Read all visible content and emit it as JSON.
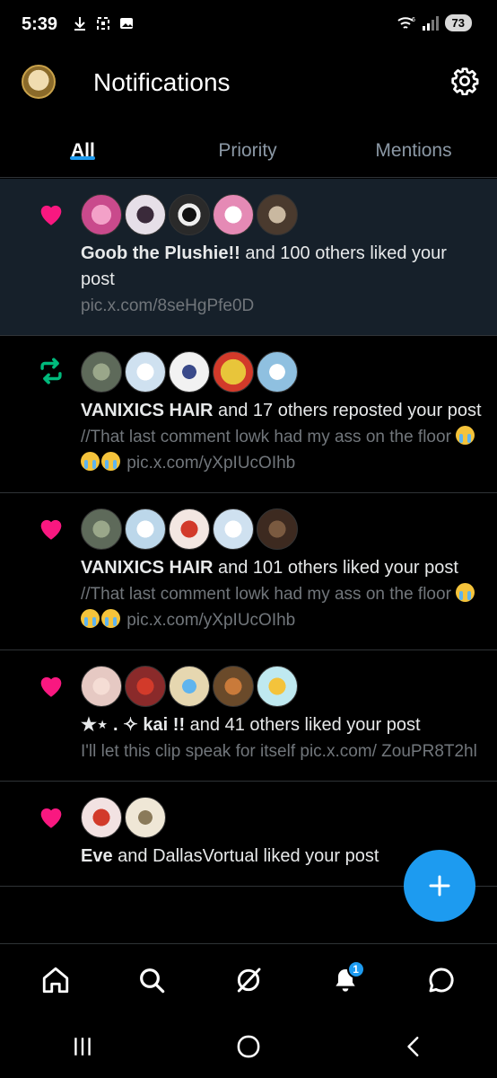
{
  "status_bar": {
    "time": "5:39",
    "battery": "73",
    "network": "6"
  },
  "header": {
    "title": "Notifications"
  },
  "tabs": [
    {
      "label": "All",
      "active": true
    },
    {
      "label": "Priority",
      "active": false
    },
    {
      "label": "Mentions",
      "active": false
    }
  ],
  "notifications": [
    {
      "kind": "like",
      "highlight": true,
      "name": "Goob the Plushie!!",
      "rest": " and 100 others liked your post",
      "sub": "pic.x.com/8seHgPfe0D",
      "avatar_colors": [
        "#c94a8c",
        "#e6dfe8",
        "#2a2a2a",
        "#e58ab5",
        "#4a3a2e"
      ]
    },
    {
      "kind": "repost",
      "highlight": false,
      "name": "VANIXICS HAIR",
      "rest": " and 17 others reposted your post",
      "sub": "//That last comment lowk had my ass on the floor",
      "sub_link": "pic.x.com/yXpIUcOIhb",
      "avatar_colors": [
        "#5e6a5a",
        "#cfe1f0",
        "#f2f2f2",
        "#e8c53a",
        "#8fc0e0"
      ]
    },
    {
      "kind": "like",
      "highlight": false,
      "name": "VANIXICS HAIR",
      "rest": " and 101 others liked your post",
      "sub": "//That last comment lowk had my ass on the floor",
      "sub_link": "pic.x.com/yXpIUcOIhb",
      "avatar_colors": [
        "#5e6a5a",
        "#bcd7ea",
        "#f3e7e2",
        "#cfe1f0",
        "#3d2a20"
      ]
    },
    {
      "kind": "like",
      "highlight": false,
      "name": "★⋆ . ✧ kai !!",
      "rest": " and 41 others liked your post",
      "sub": "I'll let this clip speak for itself pic.x.com/ ZouPR8T2hl",
      "avatar_colors": [
        "#e6c9c3",
        "#8a2a2a",
        "#e6d7b0",
        "#6a4a2a",
        "#bfe9f0"
      ]
    },
    {
      "kind": "like",
      "highlight": false,
      "name": "Eve",
      "rest": " and DallasVortual liked your post",
      "sub": "",
      "avatar_colors": [
        "#f2e2e2",
        "#efe7d6"
      ]
    }
  ],
  "bottom_nav": {
    "notification_badge": "1"
  },
  "colors": {
    "accent": "#1d9bf0",
    "like": "#f91880",
    "repost": "#00ba7c",
    "highlight_bg": "#16202a"
  },
  "icons": [
    "download-icon",
    "screenshot-icon",
    "image-icon",
    "wifi-icon",
    "signal-icon",
    "gear-icon",
    "heart-icon",
    "repost-icon",
    "plus-icon",
    "home-icon",
    "search-icon",
    "grok-icon",
    "bell-icon",
    "messages-icon",
    "recents-icon",
    "home-circle-icon",
    "back-icon"
  ]
}
